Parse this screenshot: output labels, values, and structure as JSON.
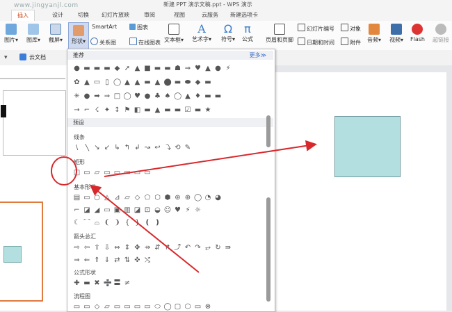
{
  "window": {
    "title": "新建 PPT 演示文稿.ppt - WPS 演示",
    "watermark": "www.jingyanjl.com"
  },
  "tabs": [
    {
      "label": "插入"
    },
    {
      "label": "设计"
    },
    {
      "label": "切换"
    },
    {
      "label": "动画"
    },
    {
      "label": "幻灯片放映"
    },
    {
      "label": "审阅"
    },
    {
      "label": "视图"
    },
    {
      "label": "云服务"
    },
    {
      "label": "新建选项卡"
    }
  ],
  "ribbon": {
    "picture": "图片",
    "gallery": "图库",
    "screenshot": "截屏",
    "shape": "形状",
    "smartart": "SmartArt",
    "chart": "图表",
    "relation": "关系图",
    "online_chart": "在线图表",
    "textbox": "文本框",
    "wordart": "艺术字",
    "symbol": "符号",
    "formula": "公式",
    "header_footer": "页眉和页脚",
    "slide_number": "幻灯片编号",
    "object": "对象",
    "datetime": "日期和时间",
    "attachment": "附件",
    "audio": "音频",
    "video": "视频",
    "flash": "Flash",
    "hyperlink": "超链接"
  },
  "subbar": {
    "cloud": "云文档"
  },
  "panel": {
    "recommended": "推荐",
    "more": "更多",
    "preset": "预设",
    "categories": {
      "lines": "线条",
      "rect": "矩形",
      "basic": "基本形状",
      "arrows": "箭头总汇",
      "formula": "公式形状",
      "flowchart": "流程图"
    },
    "recommended_rows": [
      "●▬▬▬◆➚▲■▬▬☗⇒♥▲●⚡",
      "✿▲▭▯◯▲▲▬▲⬤▬⬬◆▬",
      "✳●➡⇒□◯♥●♣♠◯▲♦▬▬",
      "→⌐☇✦↕⚑◧▬▲▬▬☑▬★"
    ],
    "lines_row": "\\╲↘↙↳↰↲↝↩⤵⟲✎",
    "rect_row": [
      "□",
      "▭",
      "▱",
      "▭",
      "▭",
      "▭",
      "▭",
      "▭"
    ],
    "basic_rows": [
      "▤▭○△⊿▱◇⬠⬡⬢⊛⊕◯◔◕",
      "⌐◪◢▭▣▥◪⊡◒☺♥⚡☼",
      "☾⌒⌓❨❩{}❪❫"
    ],
    "arrows_rows": [
      "⇨⇦⇧⇩⇔⇕✥⇸⇵↱⤴↶↷⥂↻⇛",
      "⇒⇐⇑⇓⇄⇅✜⤭"
    ],
    "formula_row": "✚▬✖➗〓≠",
    "flowchart_row": "▭▭◇▱▭▭▭▭⬭◯▢⬡▭⊗"
  },
  "colors": {
    "accent": "#d04a1f",
    "annotation": "#d8282c",
    "shape_fill": "#b4dfe0"
  }
}
